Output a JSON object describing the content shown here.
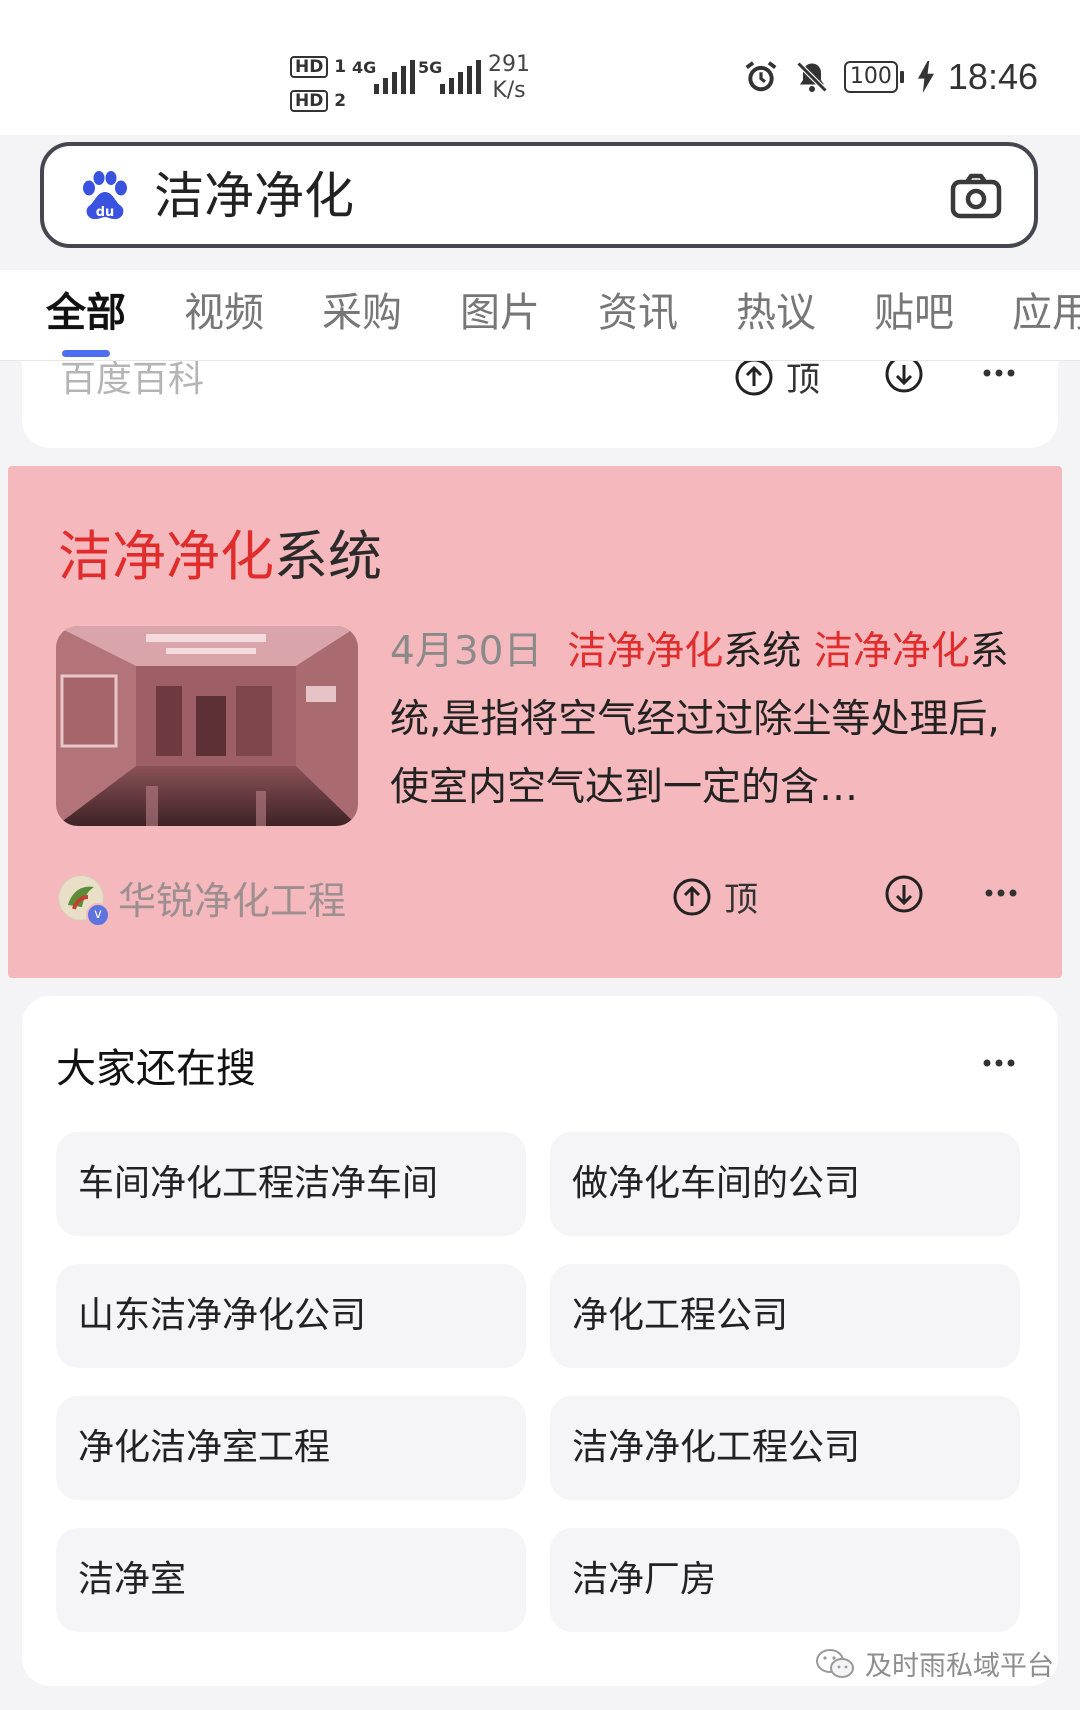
{
  "status_bar": {
    "hd1": "HD",
    "hd1_sim": "1",
    "hd2": "HD",
    "hd2_sim": "2",
    "net1": "4G",
    "net2": "5G",
    "speed_value": "291",
    "speed_unit": "K/s",
    "battery": "100",
    "time": "18:46",
    "icons": [
      "alarm-icon",
      "mute-icon",
      "battery-icon",
      "charging-icon"
    ]
  },
  "search": {
    "query": "洁净净化",
    "logo_icon": "baidu-paw-icon",
    "camera_icon": "camera-icon"
  },
  "tabs": [
    {
      "label": "全部",
      "active": true
    },
    {
      "label": "视频"
    },
    {
      "label": "采购"
    },
    {
      "label": "图片"
    },
    {
      "label": "资讯"
    },
    {
      "label": "热议"
    },
    {
      "label": "贴吧"
    },
    {
      "label": "应用"
    }
  ],
  "previous_result": {
    "source": "百度百科",
    "upvote_label": "顶"
  },
  "highlight_result": {
    "title_highlight": "洁净净化",
    "title_rest": "系统",
    "date": "4月30日",
    "snippet_hl1": "洁净净化",
    "snippet_t1": "系统",
    "snippet_hl2": "洁净净化",
    "snippet_t2": "系统,是指将空气经过过除尘等处理后,使室内空气达到一定的含…",
    "source": "华锐净化工程",
    "upvote_label": "顶",
    "background": "#f4b8bd",
    "highlight_color": "#e12c2c"
  },
  "also_search": {
    "title": "大家还在搜",
    "items": [
      "车间净化工程洁净车间",
      "做净化车间的公司",
      "山东洁净净化公司",
      "净化工程公司",
      "净化洁净室工程",
      "洁净净化工程公司",
      "洁净室",
      "洁净厂房"
    ]
  },
  "watermark": "及时雨私域平台",
  "colors": {
    "accent": "#4e6ef2",
    "highlight_red": "#e12c2c"
  }
}
